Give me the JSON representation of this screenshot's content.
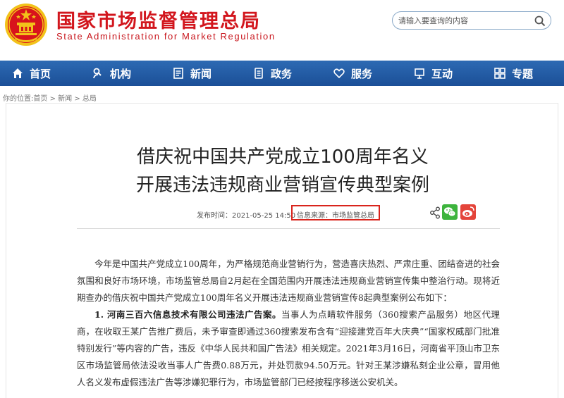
{
  "header": {
    "title_cn": "国家市场监督管理总局",
    "title_en": "State Administration for Market Regulation",
    "search_placeholder": "请输入要查询的内容"
  },
  "nav": {
    "items": [
      {
        "label": "首页",
        "icon": "home-icon"
      },
      {
        "label": "机构",
        "icon": "org-icon"
      },
      {
        "label": "新闻",
        "icon": "news-icon"
      },
      {
        "label": "政务",
        "icon": "government-icon"
      },
      {
        "label": "服务",
        "icon": "service-icon"
      },
      {
        "label": "互动",
        "icon": "interaction-icon"
      },
      {
        "label": "专题",
        "icon": "topic-icon"
      }
    ]
  },
  "breadcrumb": {
    "prefix": "你的位置:",
    "items": [
      "首页",
      "新闻",
      "总局"
    ],
    "separator": ">"
  },
  "article": {
    "title_line1": "借庆祝中国共产党成立100周年名义",
    "title_line2": "开展违法违规商业营销宣传典型案例",
    "publish_time": "发布时间：2021-05-25 14:50",
    "source": "信息来源：市场监管总局",
    "paragraph1": "今年是中国共产党成立100周年，为严格规范商业营销行为，营造喜庆热烈、严肃庄重、团结奋进的社会氛围和良好市场环境，市场监管总局自2月起在全国范围内开展违法违规商业营销宣传集中整治行动。现将近期查办的借庆祝中国共产党成立100周年名义开展违法违规商业营销宣传8起典型案例公布如下：",
    "case1_lead": "1. 河南三百六信息技术有限公司违法广告案。",
    "case1_text": "当事人为点睛软件服务（360搜索产品服务）地区代理商，在收取王某广告推广费后，未予审查即通过360搜索发布含有“迎接建党百年大庆典”“国家权威部门批准特别发行”等内容的广告，违反《中华人民共和国广告法》相关规定。2021年3月16日，河南省平顶山市卫东区市场监管局依法没收当事人广告费0.88万元，并处罚款94.50万元。针对王某涉嫌私刻企业公章，冒用他人名义发布虚假违法广告等涉嫌犯罪行为，市场监管部门已经按程序移送公安机关。"
  },
  "colors": {
    "brand_red": "#d2161d",
    "nav_blue": "#1f5aa6",
    "highlight_red": "#d9241c"
  }
}
